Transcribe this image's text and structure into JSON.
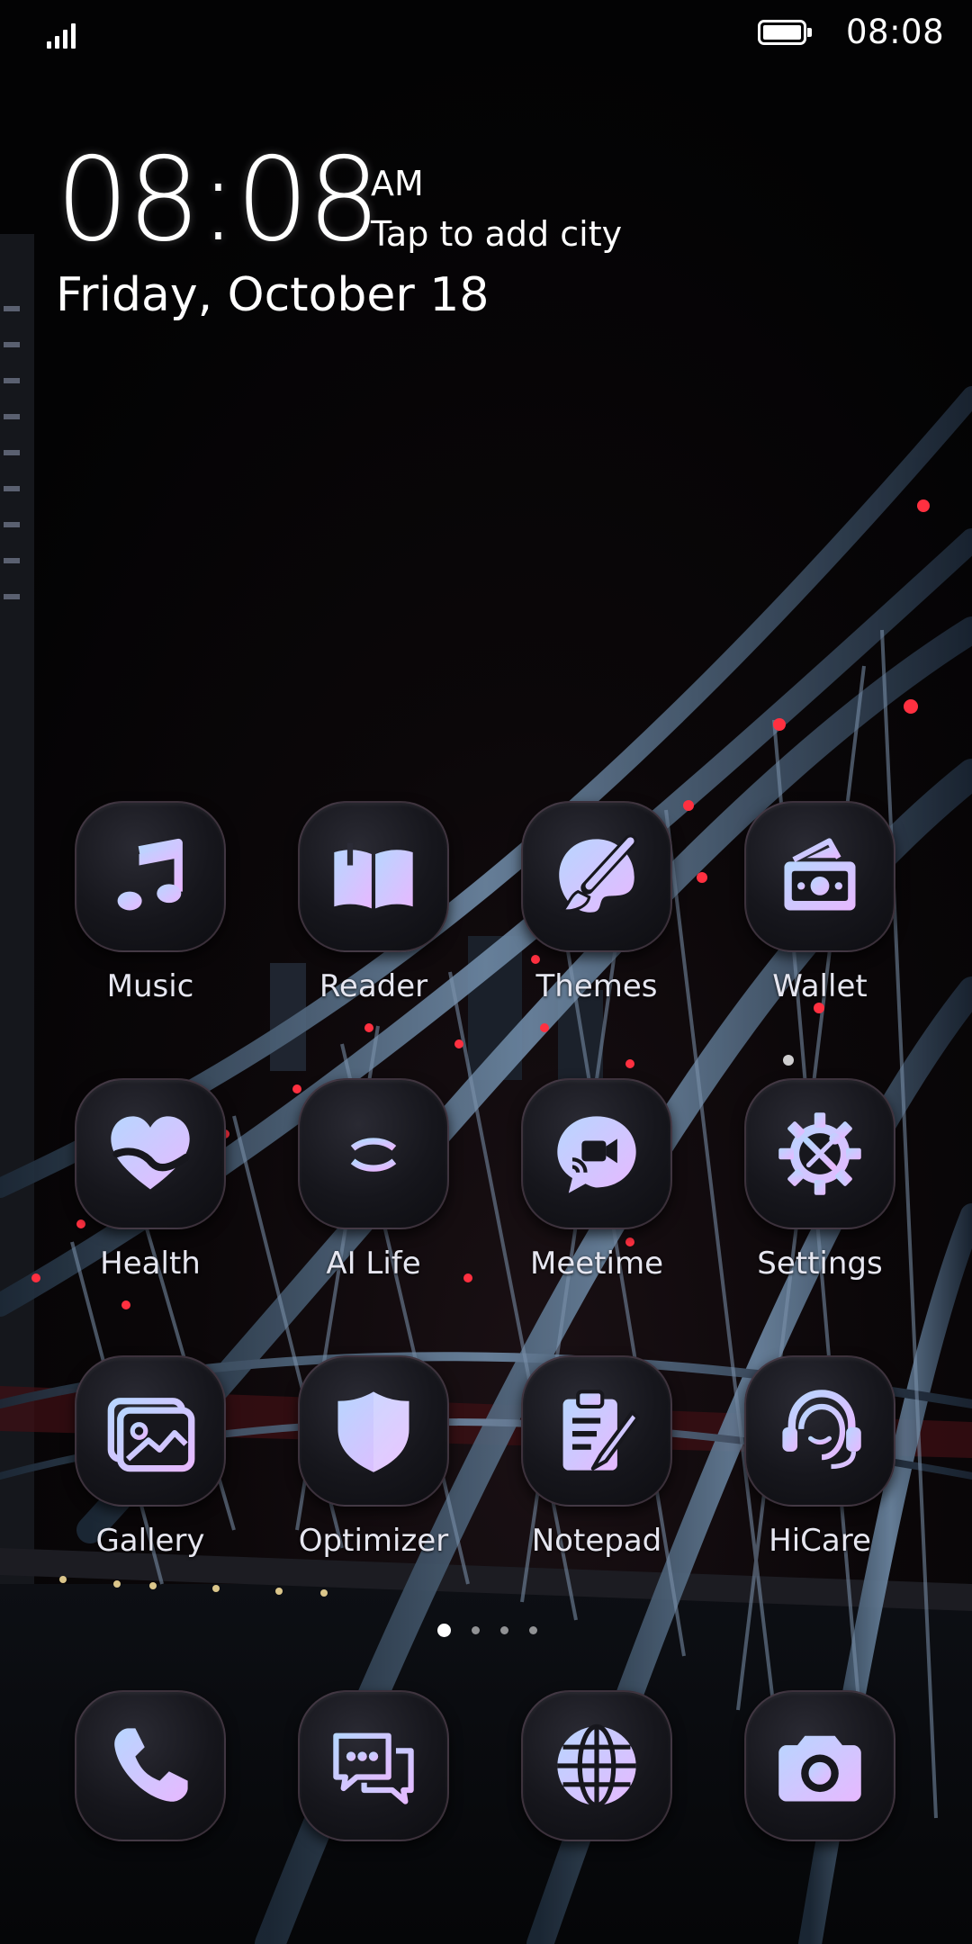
{
  "status_bar": {
    "time": "08:08",
    "battery_level": 1.0,
    "signal_bars": 4
  },
  "clock_widget": {
    "time": "08:08",
    "ampm": "AM",
    "city_prompt": "Tap to add city",
    "date": "Friday, October 18"
  },
  "apps": [
    {
      "label": "Music",
      "icon": "music-note-icon"
    },
    {
      "label": "Reader",
      "icon": "open-book-icon"
    },
    {
      "label": "Themes",
      "icon": "palette-brush-icon"
    },
    {
      "label": "Wallet",
      "icon": "wallet-cash-icon"
    },
    {
      "label": "Health",
      "icon": "heart-icon"
    },
    {
      "label": "AI Life",
      "icon": "ai-life-icon"
    },
    {
      "label": "Meetime",
      "icon": "video-chat-bubble-icon"
    },
    {
      "label": "Settings",
      "icon": "gear-tools-icon"
    },
    {
      "label": "Gallery",
      "icon": "photo-frame-icon"
    },
    {
      "label": "Optimizer",
      "icon": "shield-icon"
    },
    {
      "label": "Notepad",
      "icon": "clipboard-pencil-icon"
    },
    {
      "label": "HiCare",
      "icon": "headset-support-icon"
    }
  ],
  "dock": [
    {
      "icon": "phone-icon"
    },
    {
      "icon": "messages-icon"
    },
    {
      "icon": "globe-browser-icon"
    },
    {
      "icon": "camera-icon"
    }
  ],
  "page_indicator": {
    "total": 4,
    "current": 1
  },
  "colors": {
    "icon_gradient_start": "#b7d6ff",
    "icon_gradient_end": "#e7b8ff",
    "tile_background": "#16161c",
    "wallpaper_accent": "#ff3344"
  }
}
